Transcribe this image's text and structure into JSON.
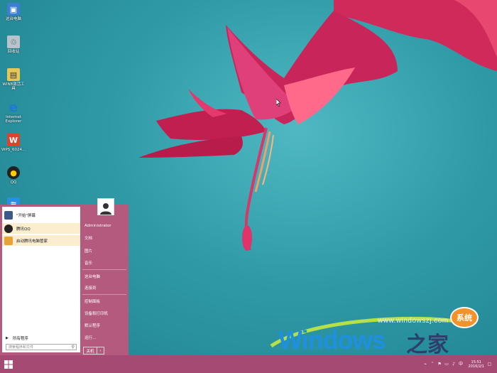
{
  "desktop_icons": [
    {
      "label": "这台电脑",
      "icon": "computer-icon",
      "color": "#3a7fd0"
    },
    {
      "label": "回收站",
      "icon": "recycle-bin-icon",
      "color": "#9ab"
    },
    {
      "label": "WIN8激活工具",
      "icon": "activation-tool-icon",
      "color": "#e6c85a"
    },
    {
      "label": "Internet Explorer",
      "icon": "ie-icon",
      "color": "#1e7bd1"
    },
    {
      "label": "WPS_6024...",
      "icon": "wps-icon",
      "color": "#d9442e"
    },
    {
      "label": "QQ",
      "icon": "qq-icon",
      "color": "#222"
    }
  ],
  "start_menu": {
    "left_items": [
      {
        "label": "\"开始\"屏幕",
        "icon": "start-screen-icon"
      },
      {
        "label": "腾讯QQ",
        "icon": "qq-icon"
      },
      {
        "label": "启动腾讯电脑管家",
        "icon": "pc-manager-icon"
      }
    ],
    "all_programs": "所有程序",
    "search_placeholder": "搜索程序和文件",
    "user_name": "Administrator",
    "right_items": [
      "文档",
      "图片",
      "音乐",
      "这台电脑",
      "连接到",
      "控制面板",
      "设备和打印机",
      "默认程序",
      "运行..."
    ],
    "shutdown_label": "关机"
  },
  "watermark": {
    "url": "www.windowszj.com",
    "brand_main": "Windows",
    "brand_suffix": "之家",
    "badge": "系统"
  },
  "taskbar": {
    "time": "15:51",
    "date": "2016/2/1"
  },
  "colors": {
    "accent": "#a54a73",
    "start_menu_bg": "#b35a7e",
    "wallpaper": "#2f9aa6",
    "highlight": "#fbeecf"
  }
}
